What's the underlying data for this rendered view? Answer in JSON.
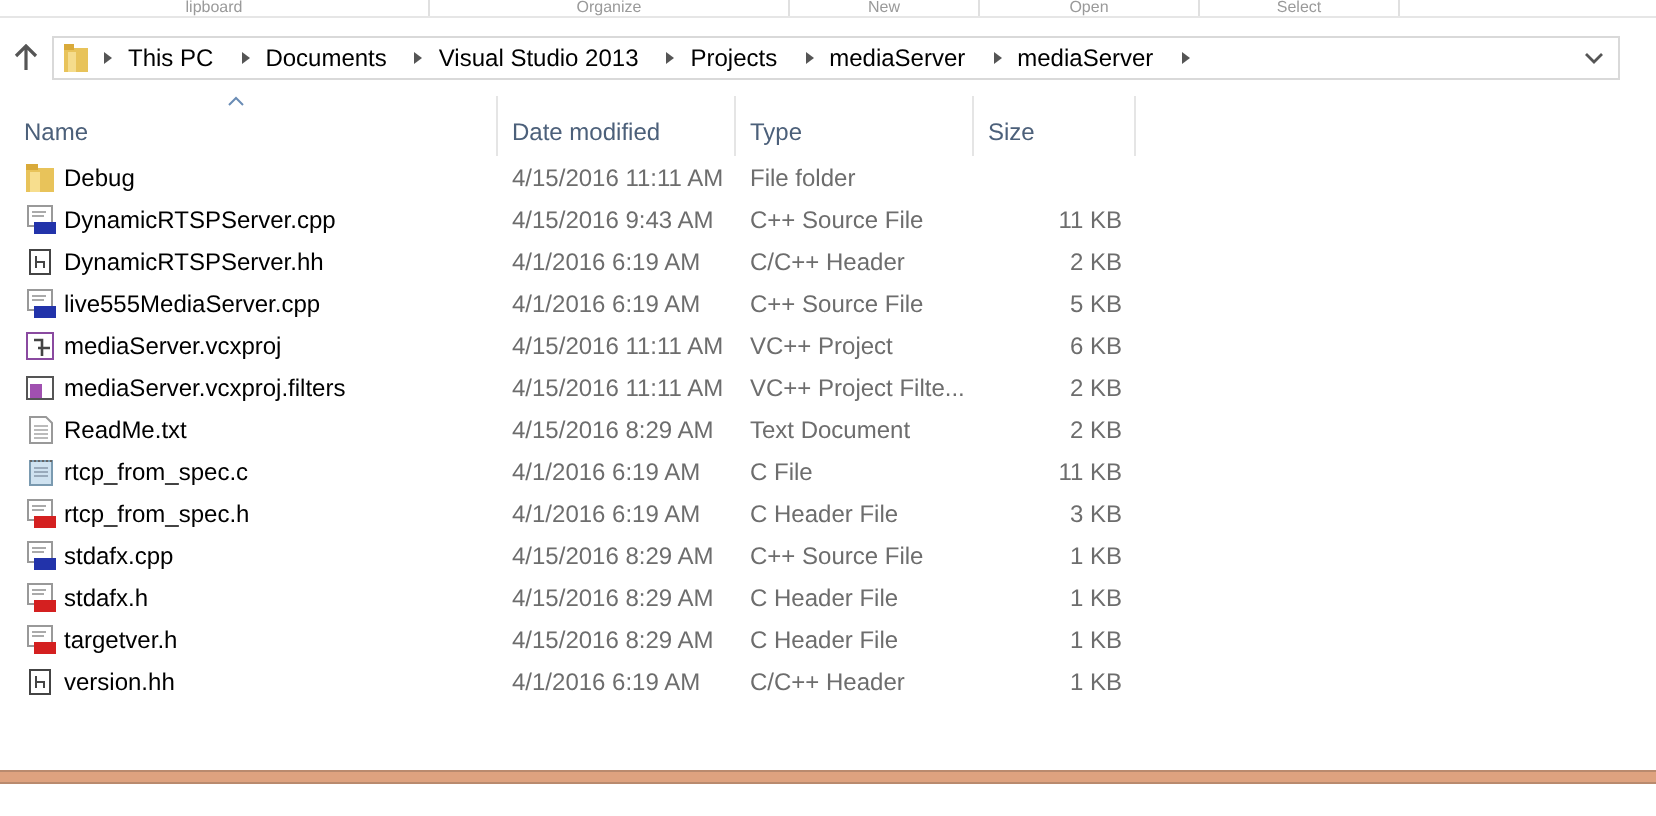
{
  "ribbon_groups": [
    "lipboard",
    "Organize",
    "New",
    "Open",
    "Select"
  ],
  "address_bar": {
    "path": [
      "This PC",
      "Documents",
      "Visual Studio 2013",
      "Projects",
      "mediaServer",
      "mediaServer"
    ]
  },
  "columns": [
    {
      "label": "Name",
      "sorted": true
    },
    {
      "label": "Date modified",
      "sorted": false
    },
    {
      "label": "Type",
      "sorted": false
    },
    {
      "label": "Size",
      "sorted": false
    }
  ],
  "files": [
    {
      "kind": "folder",
      "name": "Debug",
      "date": "4/15/2016 11:11 AM",
      "type": "File folder"
    },
    {
      "kind": "cpp",
      "name": "DynamicRTSPServer.cpp",
      "date": "4/15/2016 9:43 AM",
      "type": "C++ Source File",
      "size": "11 KB"
    },
    {
      "kind": "header",
      "name": "DynamicRTSPServer.hh",
      "date": "4/1/2016 6:19 AM",
      "type": "C/C++ Header",
      "size": "2 KB"
    },
    {
      "kind": "cpp",
      "name": "live555MediaServer.cpp",
      "date": "4/1/2016 6:19 AM",
      "type": "C++ Source File",
      "size": "5 KB"
    },
    {
      "kind": "project",
      "name": "mediaServer.vcxproj",
      "date": "4/15/2016 11:11 AM",
      "type": "VC++ Project",
      "size": "6 KB"
    },
    {
      "kind": "filters",
      "name": "mediaServer.vcxproj.filters",
      "date": "4/15/2016 11:11 AM",
      "type": "VC++ Project Filte...",
      "size": "2 KB"
    },
    {
      "kind": "text",
      "name": "ReadMe.txt",
      "date": "4/15/2016 8:29 AM",
      "type": "Text Document",
      "size": "2 KB"
    },
    {
      "kind": "c",
      "name": "rtcp_from_spec.c",
      "date": "4/1/2016 6:19 AM",
      "type": "C File",
      "size": "11 KB"
    },
    {
      "kind": "h",
      "name": "rtcp_from_spec.h",
      "date": "4/1/2016 6:19 AM",
      "type": "C Header File",
      "size": "3 KB"
    },
    {
      "kind": "cpp",
      "name": "stdafx.cpp",
      "date": "4/15/2016 8:29 AM",
      "type": "C++ Source File",
      "size": "1 KB"
    },
    {
      "kind": "h",
      "name": "stdafx.h",
      "date": "4/15/2016 8:29 AM",
      "type": "C Header File",
      "size": "1 KB"
    },
    {
      "kind": "h",
      "name": "targetver.h",
      "date": "4/15/2016 8:29 AM",
      "type": "C Header File",
      "size": "1 KB"
    },
    {
      "kind": "header",
      "name": "version.hh",
      "date": "4/1/2016 6:19 AM",
      "type": "C/C++ Header",
      "size": "1 KB"
    }
  ]
}
